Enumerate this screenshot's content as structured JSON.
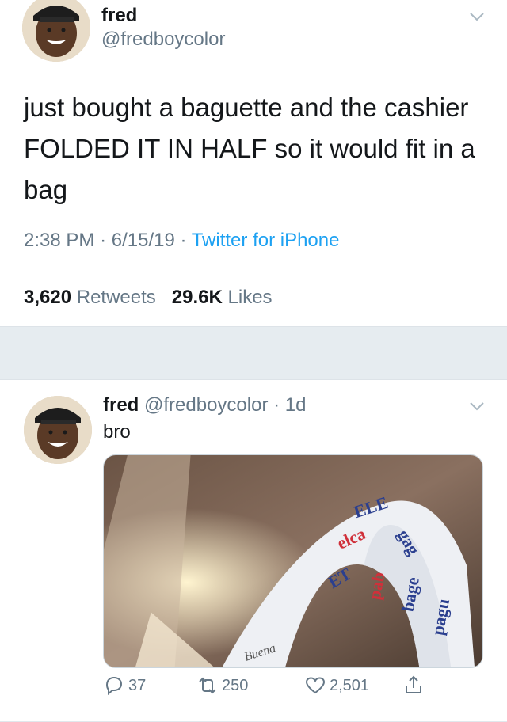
{
  "main_tweet": {
    "name": "fred",
    "handle": "@fredboycolor",
    "text": "just bought a baguette and the cashier FOLDED IT IN HALF so it would fit in a bag",
    "time": "2:38 PM",
    "date": "6/15/19",
    "separator": "·",
    "source": "Twitter for iPhone",
    "retweets_count": "3,620",
    "retweets_label": "Retweets",
    "likes_count": "29.6K",
    "likes_label": "Likes"
  },
  "reply": {
    "name": "fred",
    "handle": "@fredboycolor",
    "separator": "·",
    "age": "1d",
    "text": "bro",
    "replies": "37",
    "retweets": "250",
    "likes": "2,501"
  },
  "icons": {
    "caret": "chevron-down-icon",
    "reply": "reply-icon",
    "retweet": "retweet-icon",
    "like": "heart-icon",
    "share": "share-icon"
  },
  "colors": {
    "link": "#1da1f2",
    "secondary_text": "#657786",
    "primary_text": "#14171a",
    "separator_band": "#e6ecf0"
  }
}
